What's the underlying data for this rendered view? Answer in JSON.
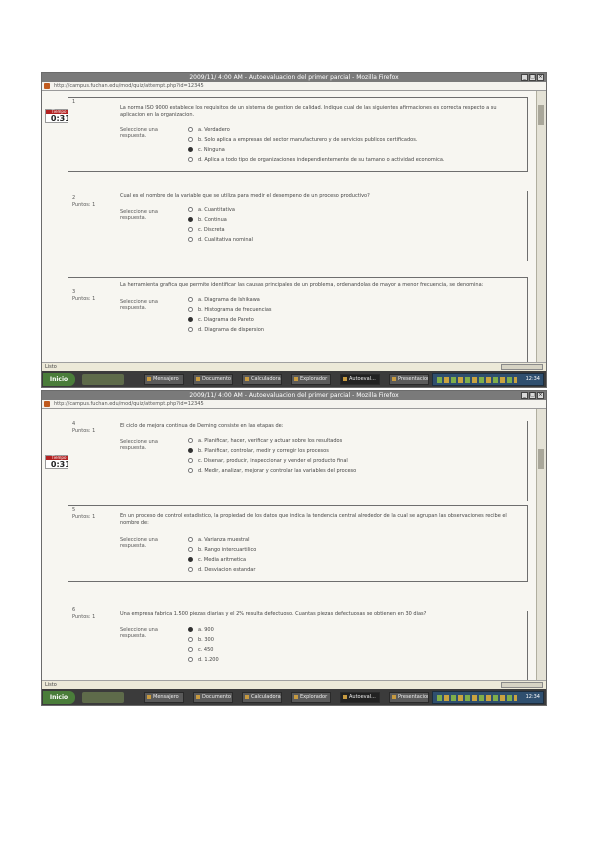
{
  "window_title": "2009/11/ 4:00 AM - Autoevaluacion del primer parcial - Mozilla Firefox",
  "address_url": "http://campus.fuchan.edu/mod/quiz/attempt.php?id=12345",
  "status_left": "Listo",
  "taskbar": {
    "start_label": "Inicio",
    "clock": "12:34",
    "buttons": [
      "Mensajero",
      "Documento",
      "Calculadora",
      "Explorador",
      "Autoeval...",
      "Presentacion"
    ],
    "active_button": "Autoeval..."
  },
  "timer_label": "Tiempo restante",
  "screens": [
    {
      "timer": "0:31:55",
      "questions": [
        {
          "number": "1",
          "score": "",
          "text": "La norma ISO 9000 establece los requisitos de un sistema de gestion de calidad. Indique cual de las siguientes afirmaciones es correcta respecto a su aplicacion en la organizacion.",
          "answer_label": "Seleccione una respuesta.",
          "options": [
            {
              "text": "a. Verdadero",
              "selected": false
            },
            {
              "text": "b. Solo aplica a empresas del sector manufacturero y de servicios publicos certificados.",
              "selected": false
            },
            {
              "text": "c. Ninguna",
              "selected": true
            },
            {
              "text": "d. Aplica a todo tipo de organizaciones independientemente de su tamano o actividad economica.",
              "selected": false
            }
          ]
        },
        {
          "number": "2",
          "score": "Puntos: 1",
          "text": "Cual es el nombre de la variable que se utiliza para medir el desempeno de un proceso productivo?",
          "answer_label": "Seleccione una respuesta.",
          "options": [
            {
              "text": "a. Cuantitativa",
              "selected": false
            },
            {
              "text": "b. Continua",
              "selected": true
            },
            {
              "text": "c. Discreta",
              "selected": false
            },
            {
              "text": "d. Cualitativa nominal",
              "selected": false
            }
          ]
        },
        {
          "number": "3",
          "score": "Puntos: 1",
          "text": "La herramienta grafica que permite identificar las causas principales de un problema, ordenandolas de mayor a menor frecuencia, se denomina:",
          "answer_label": "Seleccione una respuesta.",
          "options": [
            {
              "text": "a. Diagrama de Ishikawa",
              "selected": false
            },
            {
              "text": "b. Histograma de frecuencias",
              "selected": false
            },
            {
              "text": "c. Diagrama de Pareto",
              "selected": true
            },
            {
              "text": "d. Diagrama de dispersion",
              "selected": false
            }
          ]
        }
      ]
    },
    {
      "timer": "0:31:43",
      "questions": [
        {
          "number": "4",
          "score": "Puntos: 1",
          "text": "El ciclo de mejora continua de Deming consiste en las etapas de:",
          "answer_label": "Seleccione una respuesta.",
          "options": [
            {
              "text": "a. Planificar, hacer, verificar y actuar sobre los resultados",
              "selected": false
            },
            {
              "text": "b. Planificar, controlar, medir y corregir los procesos",
              "selected": true
            },
            {
              "text": "c. Disenar, producir, inspeccionar y vender el producto final",
              "selected": false
            },
            {
              "text": "d. Medir, analizar, mejorar y controlar las variables del proceso",
              "selected": false
            }
          ]
        },
        {
          "number": "5",
          "score": "Puntos: 1",
          "text": "En un proceso de control estadistico, la propiedad de los datos que indica la tendencia central alrededor de la cual se agrupan las observaciones recibe el nombre de:",
          "answer_label": "Seleccione una respuesta.",
          "options": [
            {
              "text": "a. Varianza muestral",
              "selected": false
            },
            {
              "text": "b. Rango intercuartilico",
              "selected": false
            },
            {
              "text": "c. Media aritmetica",
              "selected": true
            },
            {
              "text": "d. Desviacion estandar",
              "selected": false
            }
          ]
        },
        {
          "number": "6",
          "score": "Puntos: 1",
          "text": "Una empresa fabrica 1.500 piezas diarias y el 2% resulta defectuoso. Cuantas piezas defectuosas se obtienen en 30 dias?",
          "answer_label": "Seleccione una respuesta.",
          "options": [
            {
              "text": "a. 900",
              "selected": true
            },
            {
              "text": "b. 300",
              "selected": false
            },
            {
              "text": "c. 450",
              "selected": false
            },
            {
              "text": "d. 1.200",
              "selected": false
            }
          ]
        }
      ]
    }
  ]
}
